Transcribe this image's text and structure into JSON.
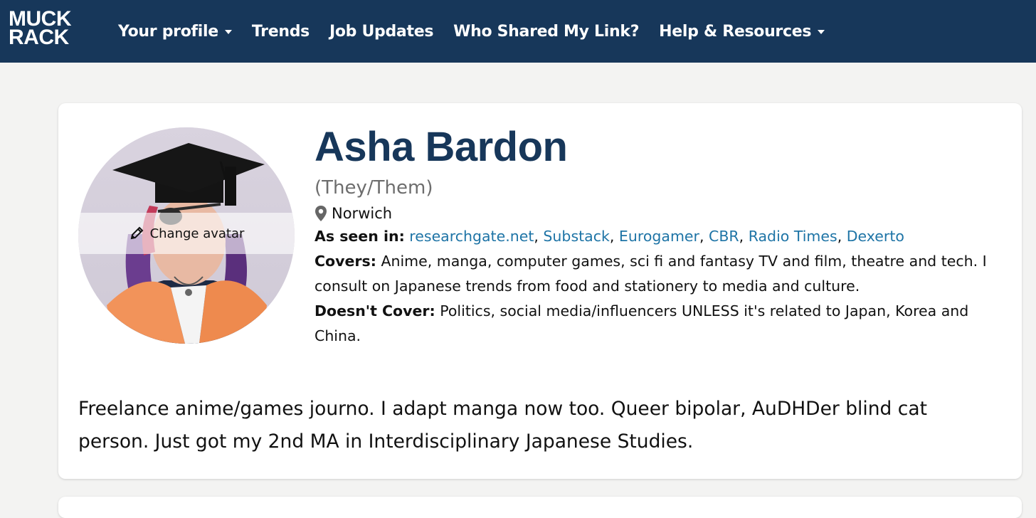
{
  "nav": {
    "logo_line1": "MUCK",
    "logo_line2": "RACK",
    "items": [
      {
        "label": "Your profile",
        "dropdown": true
      },
      {
        "label": "Trends",
        "dropdown": false
      },
      {
        "label": "Job Updates",
        "dropdown": false
      },
      {
        "label": "Who Shared My Link?",
        "dropdown": false
      },
      {
        "label": "Help & Resources",
        "dropdown": true
      }
    ]
  },
  "profile": {
    "name": "Asha Bardon",
    "pronouns": "(They/Them)",
    "location": "Norwich",
    "change_avatar_label": "Change avatar",
    "as_seen_in_label": "As seen in:",
    "outlets": [
      "researchgate.net",
      "Substack",
      "Eurogamer",
      "CBR",
      "Radio Times",
      "Dexerto"
    ],
    "covers_label": "Covers:",
    "covers_text": "Anime, manga, computer games, sci fi and fantasy TV and film, theatre and tech. I consult on Japanese trends from food and stationery to media and culture.",
    "doesnt_cover_label": "Doesn't Cover:",
    "doesnt_cover_text": "Politics, social media/influencers UNLESS it's related to Japan, Korea and China.",
    "bio": "Freelance anime/games journo. I adapt manga now too. Queer bipolar, AuDHDer blind cat person. Just got my 2nd MA in Interdisciplinary Japanese Studies."
  },
  "colors": {
    "nav_bg": "#17375a",
    "name": "#17375a",
    "link": "#1e74a6",
    "page_bg": "#f3f3f2"
  }
}
